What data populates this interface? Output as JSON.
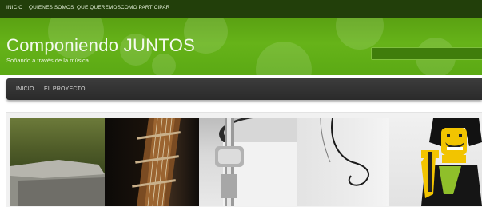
{
  "top_nav": {
    "items": [
      "INICIO",
      "QUIENES SOMOS",
      "QUE QUEREMOS",
      "COMO PARTICIPAR"
    ]
  },
  "header": {
    "title": "Componiendo JUNTOS",
    "tagline": "Soñando a través de la música"
  },
  "main_nav": {
    "items": [
      "INICIO",
      "EL PROYECTO"
    ]
  },
  "slider": {
    "panels": [
      "grass-and-stone",
      "guitar-neck",
      "drum-hardware",
      "cable-coil",
      "lego-rocker"
    ]
  },
  "colors": {
    "topnav_bg": "#223f0a",
    "banner_green": "#66b319",
    "mainnav_bg": "#2f2f2f"
  }
}
